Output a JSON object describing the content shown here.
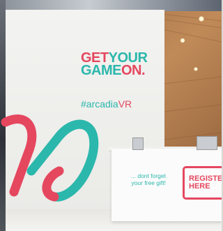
{
  "wall": {
    "slogan_get": "GET",
    "slogan_your": "YOUR",
    "slogan_game": "GAME",
    "slogan_on": "ON.",
    "hashtag_main": "#arcadia",
    "hashtag_vr": "VR"
  },
  "desk": {
    "note_line1": "... dont forget",
    "note_line2": "your free gift!",
    "register_line1": "REGISTER",
    "register_line2": "HERE"
  },
  "colors": {
    "teal": "#2bb7ac",
    "pink": "#e5475f",
    "wood": "#b07b4f"
  }
}
